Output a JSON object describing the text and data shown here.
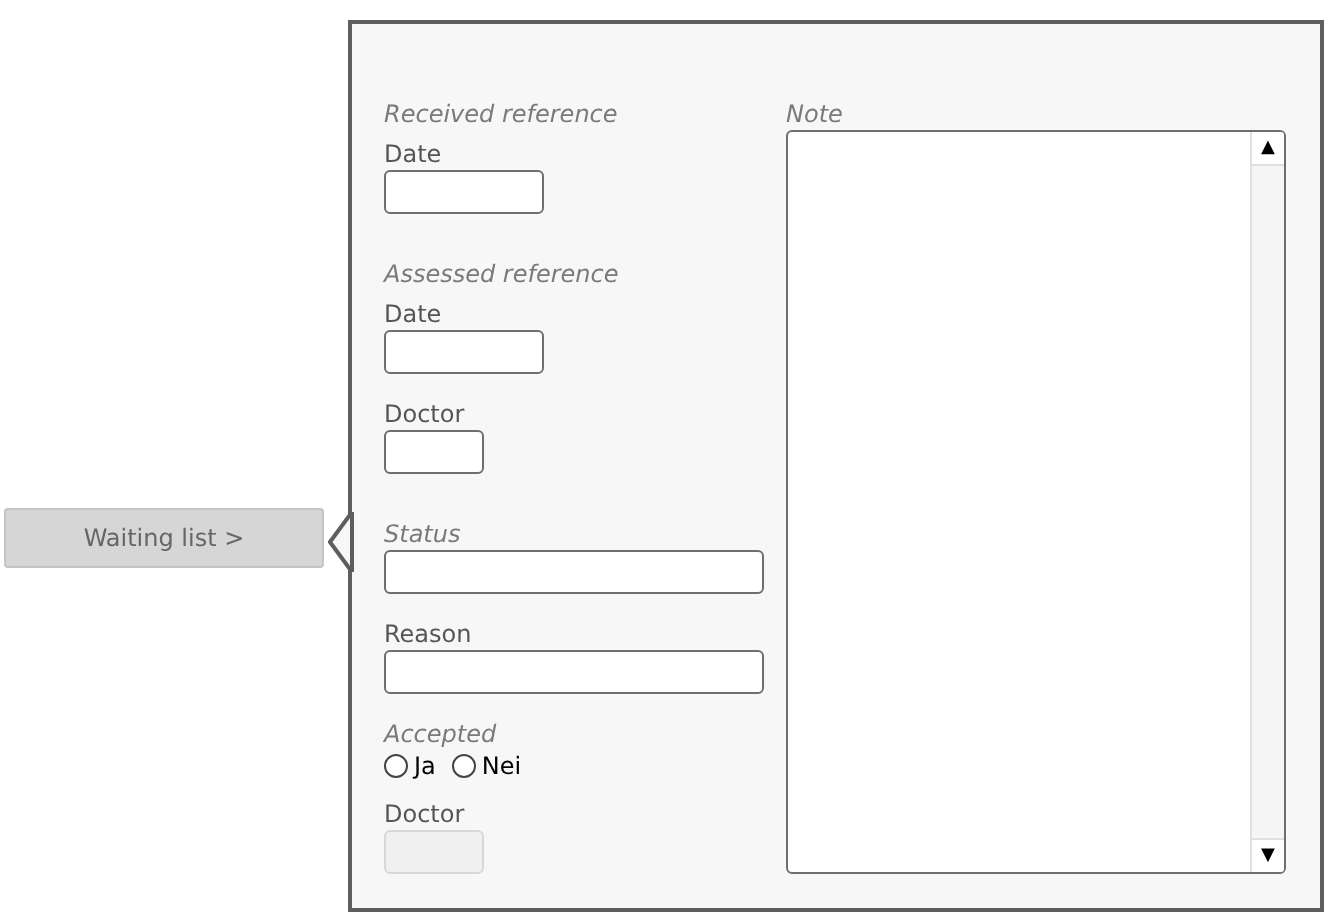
{
  "side_button": {
    "label": "Waiting list >"
  },
  "received_reference": {
    "heading": "Received reference",
    "date_label": "Date"
  },
  "assessed_reference": {
    "heading": "Assessed reference",
    "date_label": "Date",
    "doctor_label": "Doctor"
  },
  "status": {
    "heading": "Status"
  },
  "reason": {
    "label": "Reason"
  },
  "accepted": {
    "heading": "Accepted",
    "options": [
      {
        "label": "Ja",
        "selected": false
      },
      {
        "label": "Nei",
        "selected": false
      }
    ]
  },
  "accepted_doctor": {
    "label": "Doctor",
    "disabled": true
  },
  "note": {
    "heading": "Note"
  },
  "scrollbar": {
    "up": "▲",
    "down": "▼"
  }
}
